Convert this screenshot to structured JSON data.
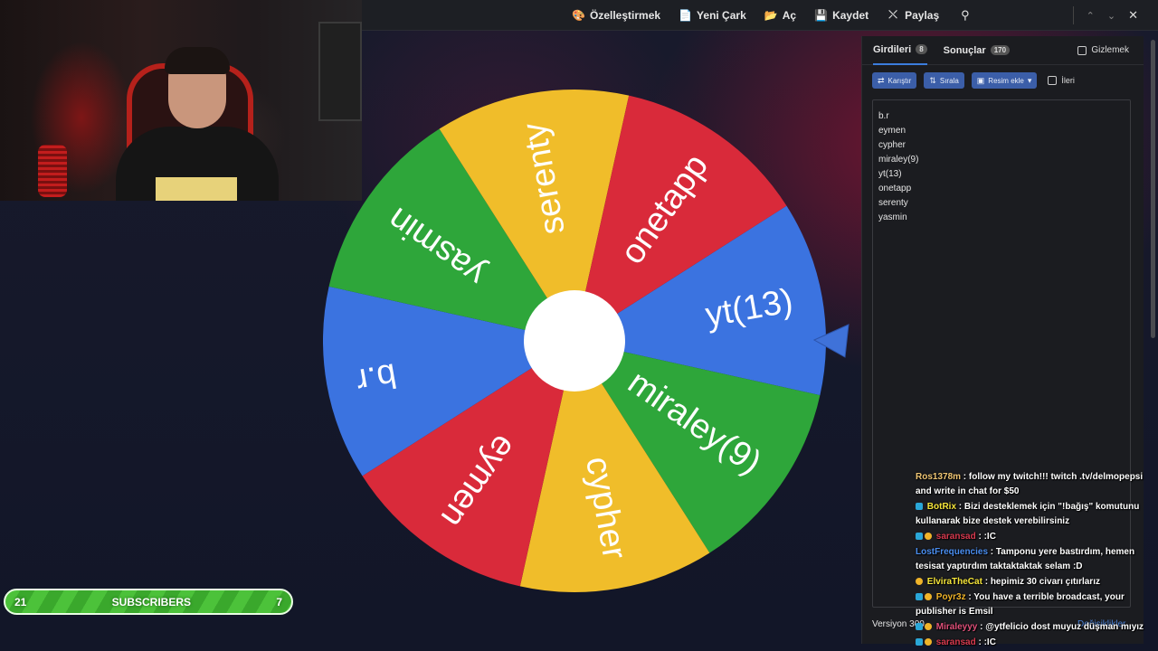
{
  "menu": {
    "items": [
      {
        "label": "Özelleştirmek",
        "icon": "palette-icon"
      },
      {
        "label": "Yeni Çark",
        "icon": "document-icon"
      },
      {
        "label": "Aç",
        "icon": "folder-icon"
      },
      {
        "label": "Kaydet",
        "icon": "save-icon"
      },
      {
        "label": "Paylaş",
        "icon": "share-icon"
      }
    ]
  },
  "wheel": {
    "segments": [
      {
        "label": "yt(13)",
        "color": "#3b73e0"
      },
      {
        "label": "miraley(9)",
        "color": "#2ea63a"
      },
      {
        "label": "cypher",
        "color": "#f0bd2a"
      },
      {
        "label": "eymen",
        "color": "#d92a3a"
      },
      {
        "label": "b.r",
        "color": "#3b73e0"
      },
      {
        "label": "yasmin",
        "color": "#2ea63a"
      },
      {
        "label": "serenty",
        "color": "#f0bd2a"
      },
      {
        "label": "onetapp",
        "color": "#d92a3a"
      }
    ]
  },
  "panel": {
    "tab_entries": "Girdileri",
    "entries_count": "8",
    "tab_results": "Sonuçlar",
    "results_count": "170",
    "hide_label": "Gizlemek",
    "shuffle_label": "Karıştır",
    "sort_label": "Sırala",
    "add_image_label": "Resim ekle",
    "advanced_label": "İleri",
    "entries": [
      "b.r",
      "eymen",
      "cypher",
      "miraley(9)",
      "yt(13)",
      "onetapp",
      "serenty",
      "yasmin"
    ],
    "version": "Versiyon 300",
    "changes_label": "Değişiklikler"
  },
  "chat": [
    {
      "user": "Ros1378m",
      "color": "#f0c674",
      "text": "follow my twitch!!! twitch .tv/delmopepsi and write in chat for $50"
    },
    {
      "user": "BotRix",
      "color": "#f5e53a",
      "text": "Bizi desteklemek için \"!bağış\" komutunu kullanarak bize destek verebilirsiniz"
    },
    {
      "user": "saransad",
      "color": "#d83a4f",
      "text": ":IC"
    },
    {
      "user": "LostFrequencies",
      "color": "#4a8ef0",
      "text": "Tamponu yere bastırdım, hemen tesisat yaptırdım taktaktaktak selam :D"
    },
    {
      "user": "ElviraTheCat",
      "color": "#f5e53a",
      "text": "hepimiz 30 civarı çıtırlarız"
    },
    {
      "user": "Poyr3z",
      "color": "#f0b429",
      "text": "You have a terrible broadcast, your publisher is Emsil"
    },
    {
      "user": "Miraleyyy",
      "color": "#e0507a",
      "text": "@ytfelicio dost muyuz düşman mıyız"
    },
    {
      "user": "saransad",
      "color": "#d83a4f",
      "text": ":IC"
    }
  ],
  "subscribers": {
    "left": "21",
    "label": "SUBSCRIBERS",
    "right": "7"
  }
}
